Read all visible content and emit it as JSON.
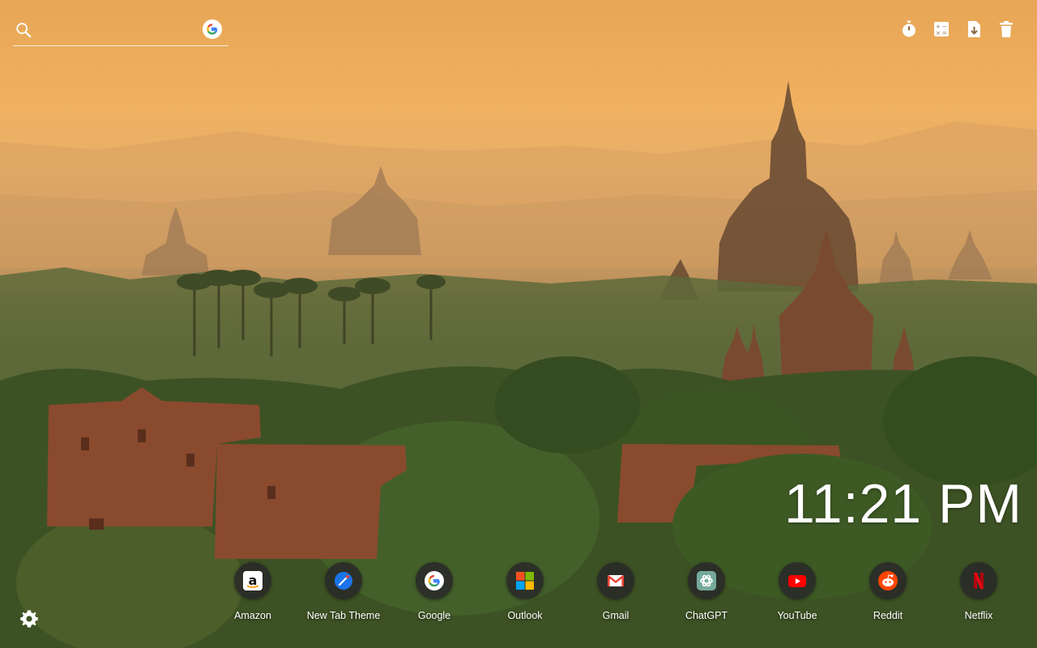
{
  "search": {
    "placeholder": "",
    "icon": "search-icon",
    "engine_icon": "google-icon"
  },
  "tools": [
    {
      "name": "timer-icon"
    },
    {
      "name": "calculator-icon"
    },
    {
      "name": "file-download-icon"
    },
    {
      "name": "trash-icon"
    }
  ],
  "clock": {
    "time": "11:21 PM"
  },
  "shortcuts": [
    {
      "label": "Amazon",
      "icon": "amazon-icon"
    },
    {
      "label": "New Tab Theme",
      "icon": "new-tab-theme-icon"
    },
    {
      "label": "Google",
      "icon": "google-icon"
    },
    {
      "label": "Outlook",
      "icon": "microsoft-icon"
    },
    {
      "label": "Gmail",
      "icon": "gmail-icon"
    },
    {
      "label": "ChatGPT",
      "icon": "chatgpt-icon"
    },
    {
      "label": "YouTube",
      "icon": "youtube-icon"
    },
    {
      "label": "Reddit",
      "icon": "reddit-icon"
    },
    {
      "label": "Netflix",
      "icon": "netflix-icon"
    }
  ],
  "settings": {
    "icon": "gear-icon"
  },
  "colors": {
    "sky": "#efb060",
    "foliage": "#3c4f23",
    "brick": "#8a4a2e"
  }
}
